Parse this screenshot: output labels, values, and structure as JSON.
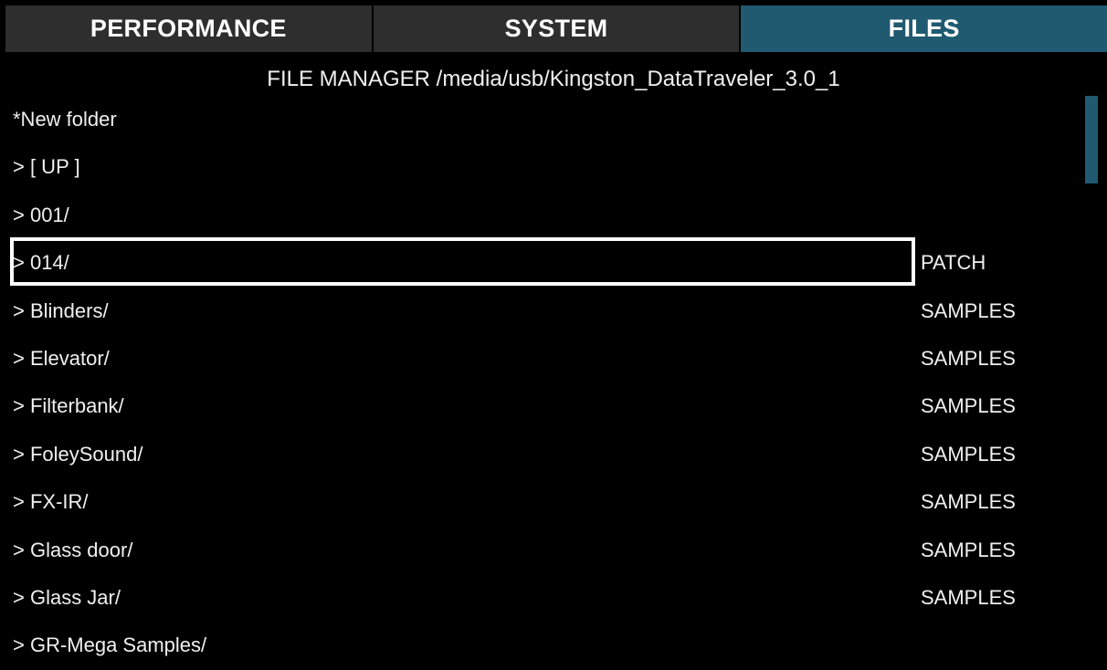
{
  "tabs": [
    {
      "label": "PERFORMANCE",
      "active": false
    },
    {
      "label": "SYSTEM",
      "active": false
    },
    {
      "label": "FILES",
      "active": true
    }
  ],
  "header": {
    "title": "FILE MANAGER /media/usb/Kingston_DataTraveler_3.0_1"
  },
  "files": [
    {
      "name": "*New folder",
      "type": ""
    },
    {
      "name": "> [ UP ]",
      "type": ""
    },
    {
      "name": "> 001/",
      "type": ""
    },
    {
      "name": "> 014/",
      "type": "PATCH",
      "selected": true
    },
    {
      "name": "> Blinders/",
      "type": "SAMPLES"
    },
    {
      "name": "> Elevator/",
      "type": "SAMPLES"
    },
    {
      "name": "> Filterbank/",
      "type": "SAMPLES"
    },
    {
      "name": "> FoleySound/",
      "type": "SAMPLES"
    },
    {
      "name": "> FX-IR/",
      "type": "SAMPLES"
    },
    {
      "name": "> Glass door/",
      "type": "SAMPLES"
    },
    {
      "name": "> Glass Jar/",
      "type": "SAMPLES"
    },
    {
      "name": "> GR-Mega Samples/",
      "type": ""
    }
  ],
  "colors": {
    "active_tab": "#1f5a70",
    "inactive_tab": "#2e2e2e",
    "background": "#000000",
    "text": "#f0f0f0",
    "scroll_thumb": "#1f5a70"
  }
}
